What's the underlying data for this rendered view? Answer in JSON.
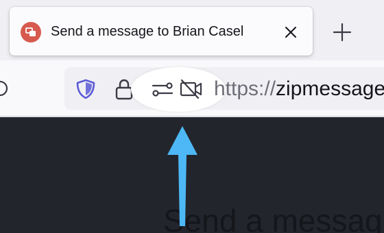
{
  "tab": {
    "title": "Send a message to Brian Casel",
    "favicon": "zipmessage-favicon",
    "close_icon": "close-icon"
  },
  "toolbar": {
    "new_tab_icon": "plus-icon",
    "reload_icon": "reload-icon"
  },
  "urlbar": {
    "scheme": "https://",
    "host": "zipmessage",
    "icons": [
      "tracking-protection-shield-icon",
      "lock-icon",
      "permissions-icon",
      "camera-blocked-icon"
    ]
  },
  "page": {
    "heading": "Send a messag"
  },
  "annotation": {
    "type": "arrow-up",
    "highlight": "permissions-and-camera-icons"
  },
  "colors": {
    "accent_arrow": "#4db8f5",
    "page_bg": "#23252d",
    "favicon_bg": "#d65a4e",
    "shield": "#5b5bd6"
  }
}
